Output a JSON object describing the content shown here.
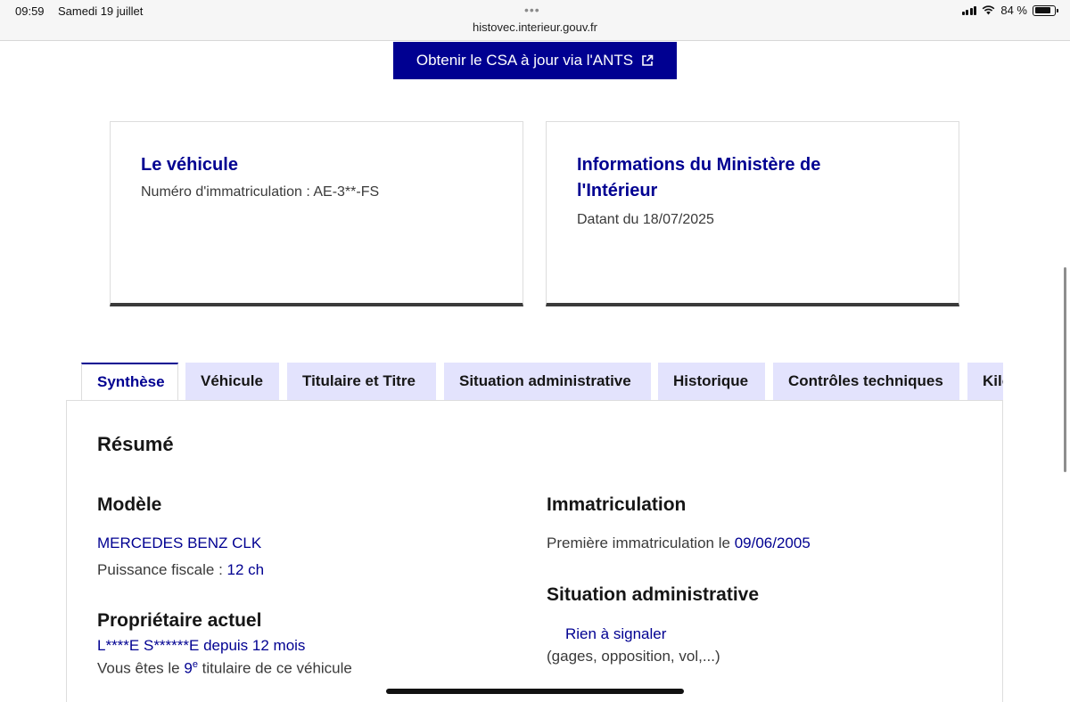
{
  "status_bar": {
    "time": "09:59",
    "date": "Samedi 19 juillet",
    "dots": "•••",
    "url": "histovec.interieur.gouv.fr",
    "battery_percent": "84 %",
    "battery_level": 0.84
  },
  "cta": {
    "label": "Obtenir le CSA à jour via l'ANTS",
    "icon": "external-link-icon"
  },
  "cards": {
    "vehicle": {
      "title": "Le véhicule",
      "plate_text": "Numéro d'immatriculation : AE-3**-FS"
    },
    "ministry": {
      "title_line1": "Informations du Ministère de",
      "title_line2": "l'Intérieur",
      "date_text": "Datant du 18/07/2025"
    }
  },
  "tabs": [
    {
      "label": "Synthèse",
      "active": true
    },
    {
      "label": "Véhicule",
      "active": false
    },
    {
      "label": "Titulaire et Titre",
      "active": false
    },
    {
      "label": "Situation administrative",
      "active": false
    },
    {
      "label": "Historique",
      "active": false
    },
    {
      "label": "Contrôles techniques",
      "active": false
    },
    {
      "label": "Kilométrage",
      "active": false
    }
  ],
  "summary": {
    "title": "Résumé",
    "model": {
      "heading": "Modèle",
      "name": "MERCEDES BENZ CLK",
      "power_label": "Puissance fiscale : ",
      "power_value": "12 ch"
    },
    "owner": {
      "heading": "Propriétaire actuel",
      "name": "L****E S******E",
      "since_label": " depuis ",
      "since_value": "12 mois",
      "rank_prefix": "Vous êtes le ",
      "rank_value": "9",
      "rank_sup": "e",
      "rank_suffix": " titulaire de ce véhicule"
    },
    "registration": {
      "heading": "Immatriculation",
      "first_label": "Première immatriculation le ",
      "first_date": "09/06/2005"
    },
    "admin": {
      "heading": "Situation administrative",
      "status": "Rien à signaler",
      "details": "(gages, opposition, vol,...)"
    }
  },
  "colors": {
    "primary": "#000091",
    "tab_bg": "#e3e3fd",
    "text": "#161616"
  }
}
